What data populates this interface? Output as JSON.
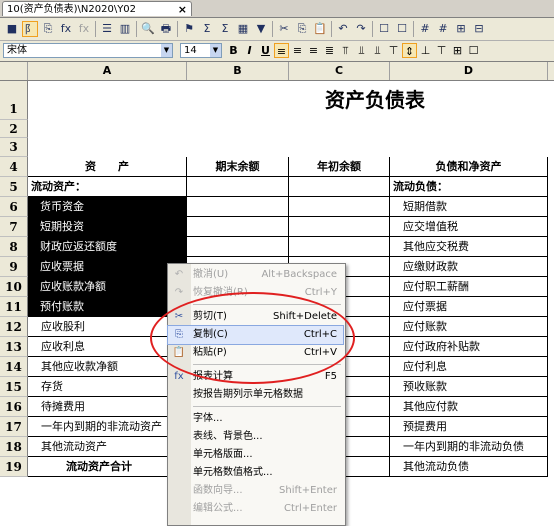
{
  "tab": {
    "title": "10(资产负债表)\\N2020\\Y02",
    "close": "×"
  },
  "toolbar1_icons": [
    "save-icon",
    "highlight-icon",
    "copy-doc-icon",
    "function-icon",
    "disabled-function-icon",
    "columns-icon",
    "layout-icon",
    "print-preview-icon",
    "print-icon",
    "formula-icon",
    "fx-icon",
    "sum-icon",
    "table-icon",
    "filter-icon",
    "cut-icon",
    "copy-icon",
    "paste-icon",
    "undo-icon",
    "redo-icon",
    "box-icon",
    "box2-icon",
    "grid-icon",
    "grid2-icon",
    "merge-icon",
    "split-icon"
  ],
  "toolbar1_glyphs": [
    "■",
    "阝",
    "⎘",
    "fx",
    "fx",
    "☰",
    "▥",
    "🔍",
    "🖶",
    "⚑",
    "Σ",
    "Σ",
    "▦",
    "▼",
    "✂",
    "⎘",
    "📋",
    "↶",
    "↷",
    "☐",
    "☐",
    "#",
    "#",
    "⊞",
    "⊟"
  ],
  "toolbar2": {
    "font": "宋体",
    "size": "14",
    "buttons": [
      {
        "name": "bold-button",
        "glyph": "B"
      },
      {
        "name": "italic-button",
        "glyph": "I"
      },
      {
        "name": "underline-button",
        "glyph": "U"
      },
      {
        "name": "align-left-button",
        "glyph": "≡"
      },
      {
        "name": "align-center-button",
        "glyph": "≡"
      },
      {
        "name": "align-right-button",
        "glyph": "≡"
      },
      {
        "name": "justify-button",
        "glyph": "≣"
      },
      {
        "name": "align-top-button",
        "glyph": "⫪"
      },
      {
        "name": "align-middle-button",
        "glyph": "⫫"
      },
      {
        "name": "align-bottom-button",
        "glyph": "⫫"
      },
      {
        "name": "wrap-button",
        "glyph": "⊤"
      },
      {
        "name": "vcenter-button",
        "glyph": "⇕"
      },
      {
        "name": "bottom-align-button",
        "glyph": "⊥"
      },
      {
        "name": "top-align-button",
        "glyph": "⊤"
      },
      {
        "name": "border-button",
        "glyph": "⊞"
      },
      {
        "name": "outline-button",
        "glyph": "☐"
      }
    ]
  },
  "columns": [
    "A",
    "B",
    "C",
    "D"
  ],
  "sheet": {
    "title": "资产负债表",
    "header": {
      "a": "资　　产",
      "b": "期末余额",
      "c": "年初余额",
      "d": "负债和净资产"
    },
    "row_numbers": [
      "1",
      "2",
      "3",
      "4",
      "5",
      "6",
      "7",
      "8",
      "9",
      "10",
      "11",
      "12",
      "13",
      "14",
      "15",
      "16",
      "17",
      "18",
      "19"
    ],
    "col_a": [
      "流动资产：",
      "货币资金",
      "短期投资",
      "财政应返还额度",
      "应收票据",
      "应收账款净额",
      "预付账款",
      "应收股利",
      "应收利息",
      "其他应收款净额",
      "存货",
      "待摊费用",
      "一年内到期的非流动资产",
      "其他流动资产",
      "流动资产合计"
    ],
    "col_d": [
      "流动负债：",
      "短期借款",
      "应交增值税",
      "其他应交税费",
      "应缴财政款",
      "应付职工薪酬",
      "应付票据",
      "应付账款",
      "应付政府补贴款",
      "应付利息",
      "预收账款",
      "其他应付款",
      "预提费用",
      "一年内到期的非流动负债",
      "其他流动负债"
    ]
  },
  "context_menu": {
    "items": [
      {
        "label": "撤消(U)",
        "shortcut": "Alt+Backspace",
        "icon": "undo-icon",
        "glyph": "↶",
        "disabled": true
      },
      {
        "label": "恢复撤消(R)",
        "shortcut": "Ctrl+Y",
        "icon": "redo-icon",
        "glyph": "↷",
        "disabled": true
      },
      {
        "label": "剪切(T)",
        "shortcut": "Shift+Delete",
        "icon": "cut-icon",
        "glyph": "✂",
        "disabled": false
      },
      {
        "label": "复制(C)",
        "shortcut": "Ctrl+C",
        "icon": "copy-icon",
        "glyph": "⎘",
        "disabled": false
      },
      {
        "label": "粘贴(P)",
        "shortcut": "Ctrl+V",
        "icon": "paste-icon",
        "glyph": "📋",
        "disabled": false
      },
      {
        "label": "报表计算",
        "shortcut": "F5",
        "icon": "calc-icon",
        "glyph": "fx",
        "disabled": false
      },
      {
        "label": "按报告期列示单元格数据",
        "shortcut": "",
        "icon": "",
        "glyph": "",
        "disabled": false
      },
      {
        "label": "字体...",
        "shortcut": "",
        "icon": "",
        "glyph": "",
        "disabled": false
      },
      {
        "label": "表线、背景色...",
        "shortcut": "",
        "icon": "",
        "glyph": "",
        "disabled": false
      },
      {
        "label": "单元格版面...",
        "shortcut": "",
        "icon": "",
        "glyph": "",
        "disabled": false
      },
      {
        "label": "单元格数值格式...",
        "shortcut": "",
        "icon": "",
        "glyph": "",
        "disabled": false
      },
      {
        "label": "函数向导...",
        "shortcut": "Shift+Enter",
        "icon": "",
        "glyph": "",
        "disabled": true
      },
      {
        "label": "编辑公式...",
        "shortcut": "Ctrl+Enter",
        "icon": "",
        "glyph": "",
        "disabled": true
      }
    ]
  }
}
